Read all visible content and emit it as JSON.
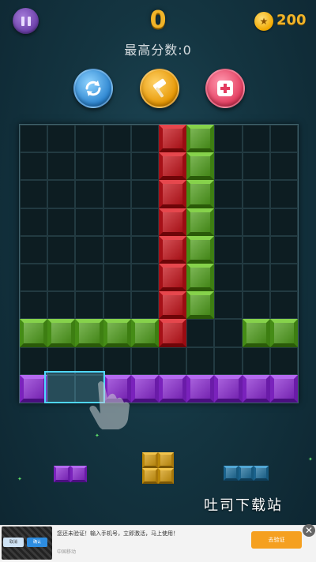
{
  "header": {
    "score": "0",
    "best_score_text": "最高分数:0",
    "coins": "200"
  },
  "icons": {
    "pause": "pause-icon",
    "coin": "coin-icon",
    "refresh": "refresh-icon",
    "hammer": "hammer-icon",
    "add": "plus-icon",
    "hand": "hand-pointer-icon"
  },
  "board": {
    "rows": 10,
    "cols": 10,
    "cells": [
      {
        "r": 0,
        "c": 5,
        "color": "red"
      },
      {
        "r": 0,
        "c": 6,
        "color": "green"
      },
      {
        "r": 1,
        "c": 5,
        "color": "red"
      },
      {
        "r": 1,
        "c": 6,
        "color": "green"
      },
      {
        "r": 2,
        "c": 5,
        "color": "red"
      },
      {
        "r": 2,
        "c": 6,
        "color": "green"
      },
      {
        "r": 3,
        "c": 5,
        "color": "red"
      },
      {
        "r": 3,
        "c": 6,
        "color": "green"
      },
      {
        "r": 4,
        "c": 5,
        "color": "red"
      },
      {
        "r": 4,
        "c": 6,
        "color": "green"
      },
      {
        "r": 5,
        "c": 5,
        "color": "red"
      },
      {
        "r": 5,
        "c": 6,
        "color": "green"
      },
      {
        "r": 6,
        "c": 5,
        "color": "red"
      },
      {
        "r": 6,
        "c": 6,
        "color": "green"
      },
      {
        "r": 7,
        "c": 0,
        "color": "green"
      },
      {
        "r": 7,
        "c": 1,
        "color": "green"
      },
      {
        "r": 7,
        "c": 2,
        "color": "green"
      },
      {
        "r": 7,
        "c": 3,
        "color": "green"
      },
      {
        "r": 7,
        "c": 4,
        "color": "green"
      },
      {
        "r": 7,
        "c": 5,
        "color": "red"
      },
      {
        "r": 7,
        "c": 8,
        "color": "green"
      },
      {
        "r": 7,
        "c": 9,
        "color": "green"
      },
      {
        "r": 9,
        "c": 0,
        "color": "purple"
      },
      {
        "r": 9,
        "c": 3,
        "color": "purple"
      },
      {
        "r": 9,
        "c": 4,
        "color": "purple"
      },
      {
        "r": 9,
        "c": 5,
        "color": "purple"
      },
      {
        "r": 9,
        "c": 6,
        "color": "purple"
      },
      {
        "r": 9,
        "c": 7,
        "color": "purple"
      },
      {
        "r": 9,
        "c": 8,
        "color": "purple"
      },
      {
        "r": 9,
        "c": 9,
        "color": "purple"
      }
    ],
    "highlight_cells": [
      {
        "r": 9,
        "c": 1
      },
      {
        "r": 9,
        "c": 2
      }
    ]
  },
  "tray": [
    {
      "name": "piece-purple-1x2",
      "color": "purple",
      "cells": [
        [
          0,
          0
        ],
        [
          0,
          1
        ]
      ]
    },
    {
      "name": "piece-yellow-2x2",
      "color": "yellow",
      "cells": [
        [
          0,
          0
        ],
        [
          0,
          1
        ],
        [
          1,
          0
        ],
        [
          1,
          1
        ]
      ]
    },
    {
      "name": "piece-blue-1x3",
      "color": "blue",
      "cells": [
        [
          0,
          0
        ],
        [
          0,
          1
        ],
        [
          0,
          2
        ]
      ]
    }
  ],
  "colors": {
    "score": "#f0b429",
    "highlight": "#4fd6ff"
  },
  "watermark": "吐司下载站",
  "ad": {
    "text": "您还未验证！输入手机号，立即激活，马上使用！",
    "sub": "中国移动",
    "button_label": "去验证",
    "close_label": "✕",
    "thumb_btn1": "取消",
    "thumb_btn2": "确认"
  }
}
